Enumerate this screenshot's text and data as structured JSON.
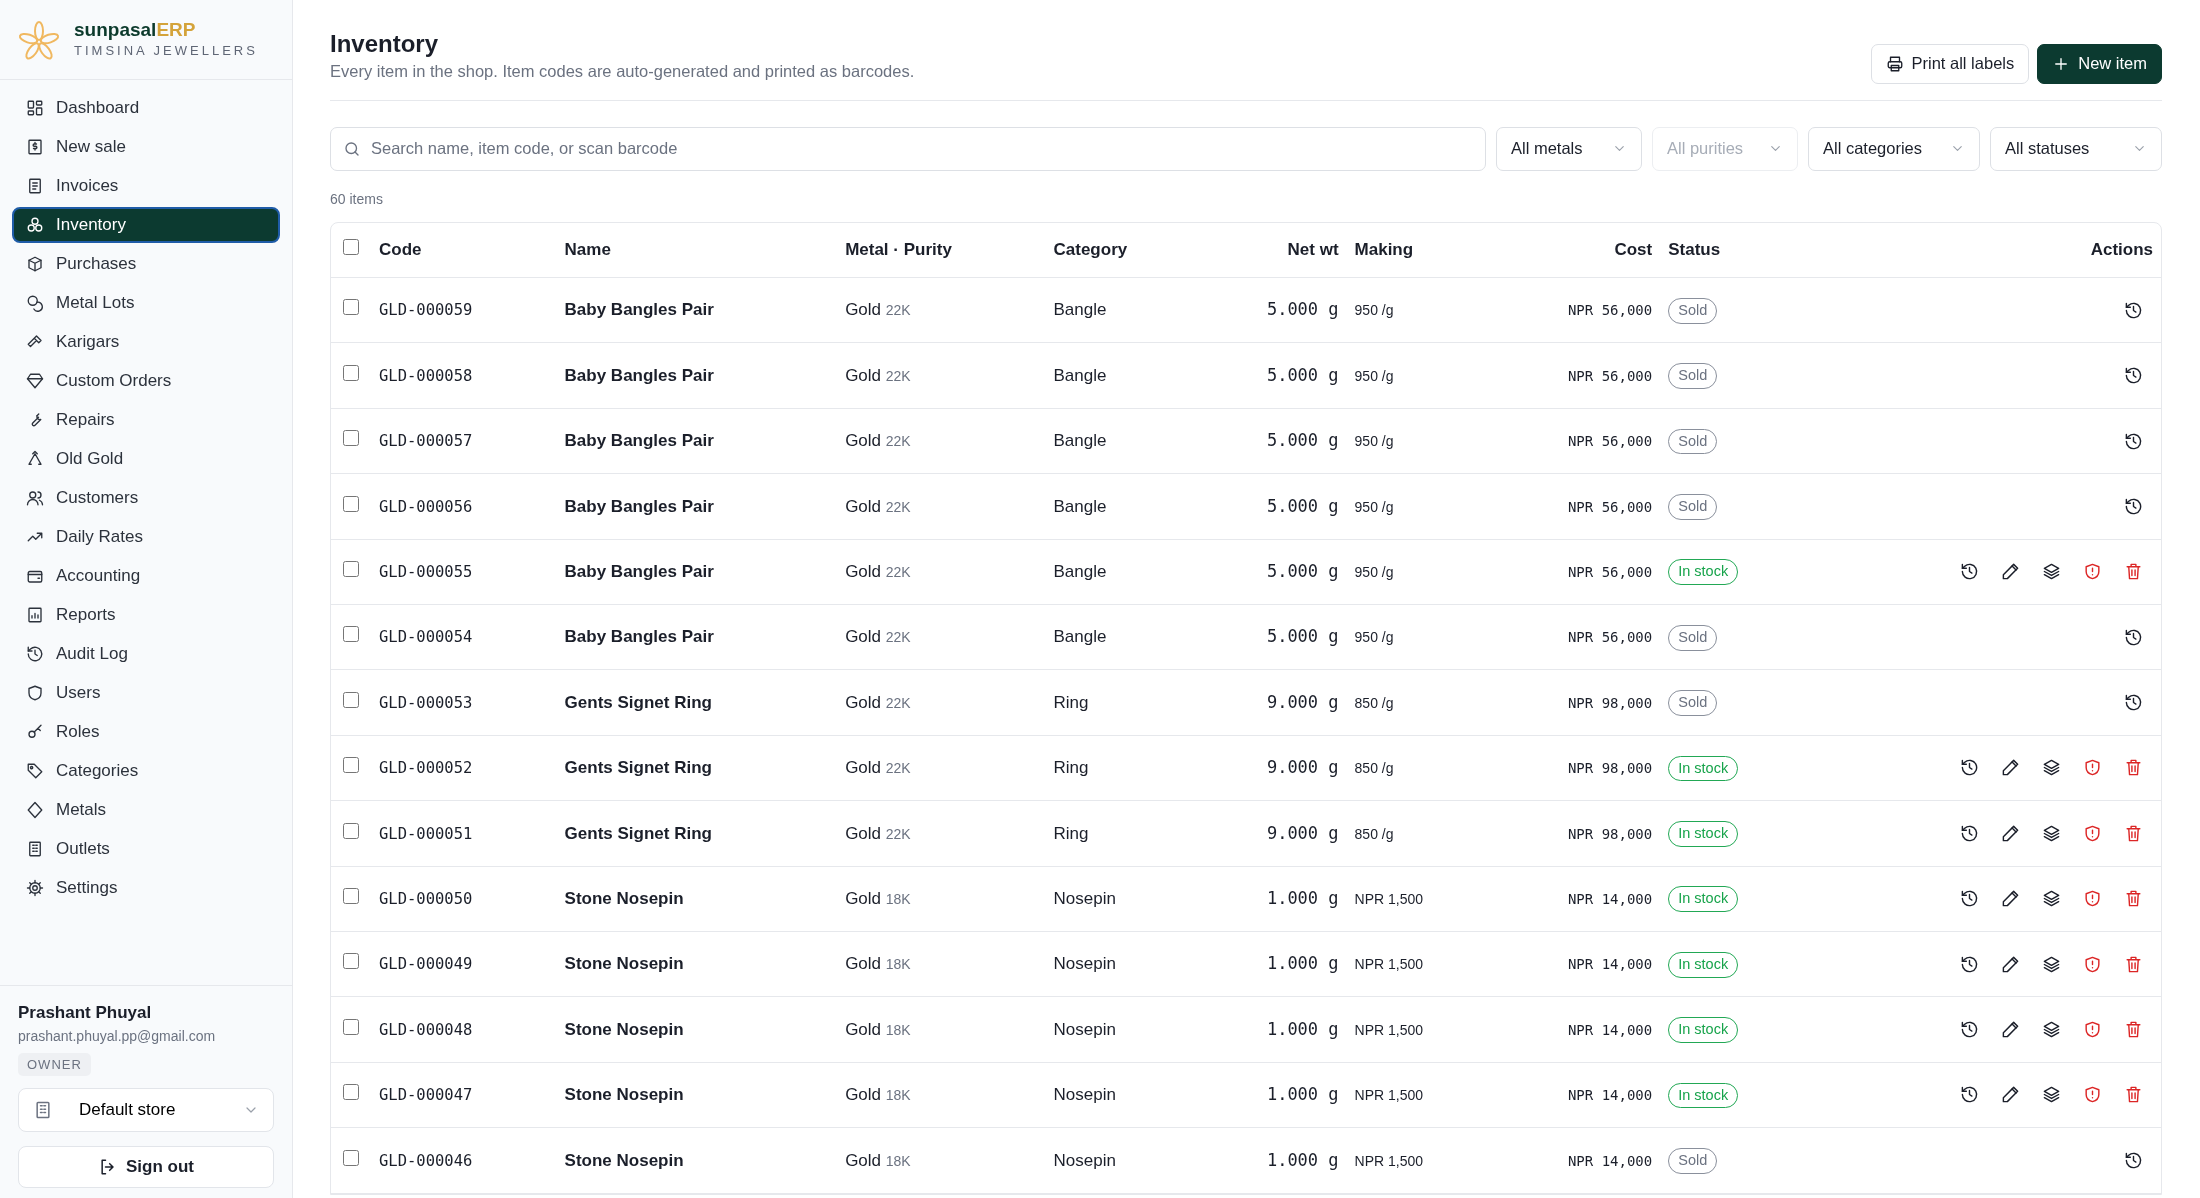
{
  "brand": {
    "name": "sunpasal",
    "name_accent": "ERP",
    "subtitle": "TIMSINA JEWELLERS"
  },
  "sidebar": {
    "items": [
      {
        "label": "Dashboard",
        "selected": false
      },
      {
        "label": "New sale",
        "selected": false
      },
      {
        "label": "Invoices",
        "selected": false
      },
      {
        "label": "Inventory",
        "selected": true
      },
      {
        "label": "Purchases",
        "selected": false
      },
      {
        "label": "Metal Lots",
        "selected": false
      },
      {
        "label": "Karigars",
        "selected": false
      },
      {
        "label": "Custom Orders",
        "selected": false
      },
      {
        "label": "Repairs",
        "selected": false
      },
      {
        "label": "Old Gold",
        "selected": false
      },
      {
        "label": "Customers",
        "selected": false
      },
      {
        "label": "Daily Rates",
        "selected": false
      },
      {
        "label": "Accounting",
        "selected": false
      },
      {
        "label": "Reports",
        "selected": false
      },
      {
        "label": "Audit Log",
        "selected": false
      },
      {
        "label": "Users",
        "selected": false
      },
      {
        "label": "Roles",
        "selected": false
      },
      {
        "label": "Categories",
        "selected": false
      },
      {
        "label": "Metals",
        "selected": false
      },
      {
        "label": "Outlets",
        "selected": false
      },
      {
        "label": "Settings",
        "selected": false
      }
    ],
    "user": {
      "name": "Prashant Phuyal",
      "email": "prashant.phuyal.pp@gmail.com",
      "role": "OWNER"
    },
    "store": "Default store",
    "sign_out": "Sign out"
  },
  "page": {
    "title": "Inventory",
    "subtitle": "Every item in the shop. Item codes are auto-generated and printed as barcodes.",
    "buttons": [
      {
        "label": "Print all labels",
        "kind": "outline"
      },
      {
        "label": "New item",
        "kind": "primary"
      }
    ]
  },
  "filters": {
    "search": {
      "placeholder": "Search name, item code, or scan barcode"
    },
    "selects": [
      {
        "label": "All metals",
        "disabled": false
      },
      {
        "label": "All purities",
        "disabled": true
      },
      {
        "label": "All categories",
        "disabled": false
      },
      {
        "label": "All statuses",
        "disabled": false
      }
    ]
  },
  "count": "60 items",
  "table": {
    "all_checked": false,
    "columns": [
      "Code",
      "Name",
      "Metal · Purity",
      "Category",
      "Net wt",
      "Making",
      "Cost",
      "Status",
      "Actions"
    ],
    "rows": [
      {
        "checked": false,
        "code": "GLD-000059",
        "name": "Baby Bangles Pair",
        "metal": "Gold",
        "purity": "22K",
        "category": "Bangle",
        "net_wt": "5.000 g",
        "making": "950 /g",
        "cost": "NPR 56,000",
        "status": "Sold",
        "in_stock": false,
        "editable": false
      },
      {
        "checked": false,
        "code": "GLD-000058",
        "name": "Baby Bangles Pair",
        "metal": "Gold",
        "purity": "22K",
        "category": "Bangle",
        "net_wt": "5.000 g",
        "making": "950 /g",
        "cost": "NPR 56,000",
        "status": "Sold",
        "in_stock": false,
        "editable": false
      },
      {
        "checked": false,
        "code": "GLD-000057",
        "name": "Baby Bangles Pair",
        "metal": "Gold",
        "purity": "22K",
        "category": "Bangle",
        "net_wt": "5.000 g",
        "making": "950 /g",
        "cost": "NPR 56,000",
        "status": "Sold",
        "in_stock": false,
        "editable": false
      },
      {
        "checked": false,
        "code": "GLD-000056",
        "name": "Baby Bangles Pair",
        "metal": "Gold",
        "purity": "22K",
        "category": "Bangle",
        "net_wt": "5.000 g",
        "making": "950 /g",
        "cost": "NPR 56,000",
        "status": "Sold",
        "in_stock": false,
        "editable": false
      },
      {
        "checked": false,
        "code": "GLD-000055",
        "name": "Baby Bangles Pair",
        "metal": "Gold",
        "purity": "22K",
        "category": "Bangle",
        "net_wt": "5.000 g",
        "making": "950 /g",
        "cost": "NPR 56,000",
        "status": "In stock",
        "in_stock": true,
        "editable": true
      },
      {
        "checked": false,
        "code": "GLD-000054",
        "name": "Baby Bangles Pair",
        "metal": "Gold",
        "purity": "22K",
        "category": "Bangle",
        "net_wt": "5.000 g",
        "making": "950 /g",
        "cost": "NPR 56,000",
        "status": "Sold",
        "in_stock": false,
        "editable": false
      },
      {
        "checked": false,
        "code": "GLD-000053",
        "name": "Gents Signet Ring",
        "metal": "Gold",
        "purity": "22K",
        "category": "Ring",
        "net_wt": "9.000 g",
        "making": "850 /g",
        "cost": "NPR 98,000",
        "status": "Sold",
        "in_stock": false,
        "editable": false
      },
      {
        "checked": false,
        "code": "GLD-000052",
        "name": "Gents Signet Ring",
        "metal": "Gold",
        "purity": "22K",
        "category": "Ring",
        "net_wt": "9.000 g",
        "making": "850 /g",
        "cost": "NPR 98,000",
        "status": "In stock",
        "in_stock": true,
        "editable": true
      },
      {
        "checked": false,
        "code": "GLD-000051",
        "name": "Gents Signet Ring",
        "metal": "Gold",
        "purity": "22K",
        "category": "Ring",
        "net_wt": "9.000 g",
        "making": "850 /g",
        "cost": "NPR 98,000",
        "status": "In stock",
        "in_stock": true,
        "editable": true
      },
      {
        "checked": false,
        "code": "GLD-000050",
        "name": "Stone Nosepin",
        "metal": "Gold",
        "purity": "18K",
        "category": "Nosepin",
        "net_wt": "1.000 g",
        "making": "NPR 1,500",
        "cost": "NPR 14,000",
        "status": "In stock",
        "in_stock": true,
        "editable": true
      },
      {
        "checked": false,
        "code": "GLD-000049",
        "name": "Stone Nosepin",
        "metal": "Gold",
        "purity": "18K",
        "category": "Nosepin",
        "net_wt": "1.000 g",
        "making": "NPR 1,500",
        "cost": "NPR 14,000",
        "status": "In stock",
        "in_stock": true,
        "editable": true
      },
      {
        "checked": false,
        "code": "GLD-000048",
        "name": "Stone Nosepin",
        "metal": "Gold",
        "purity": "18K",
        "category": "Nosepin",
        "net_wt": "1.000 g",
        "making": "NPR 1,500",
        "cost": "NPR 14,000",
        "status": "In stock",
        "in_stock": true,
        "editable": true
      },
      {
        "checked": false,
        "code": "GLD-000047",
        "name": "Stone Nosepin",
        "metal": "Gold",
        "purity": "18K",
        "category": "Nosepin",
        "net_wt": "1.000 g",
        "making": "NPR 1,500",
        "cost": "NPR 14,000",
        "status": "In stock",
        "in_stock": true,
        "editable": true
      },
      {
        "checked": false,
        "code": "GLD-000046",
        "name": "Stone Nosepin",
        "metal": "Gold",
        "purity": "18K",
        "category": "Nosepin",
        "net_wt": "1.000 g",
        "making": "NPR 1,500",
        "cost": "NPR 14,000",
        "status": "Sold",
        "in_stock": false,
        "editable": false
      }
    ]
  }
}
